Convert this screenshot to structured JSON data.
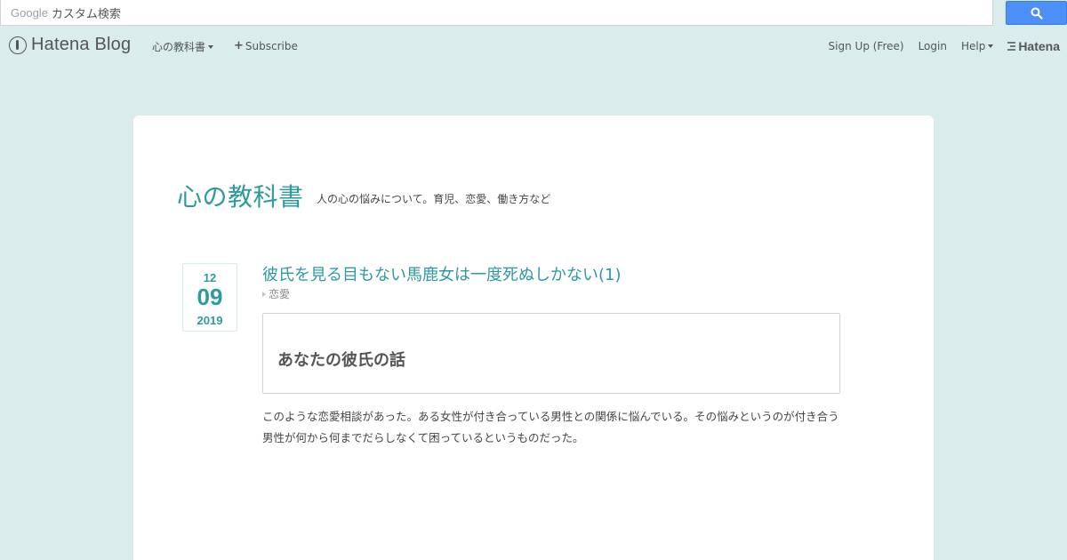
{
  "search": {
    "google_label": "Google",
    "placeholder": "カスタム検索",
    "button_icon": "search-icon",
    "button_color": "#4b8ff7"
  },
  "header": {
    "brand": "Hatena Blog",
    "blog_menu": "心の教科書",
    "subscribe": "Subscribe",
    "signup": "Sign Up (Free)",
    "login": "Login",
    "help": "Help",
    "hatena": "Hatena"
  },
  "blog": {
    "title": "心の教科書",
    "description": "人の心の悩みについて。育児、恋愛、働き方など",
    "accent_color": "#2e9a9e"
  },
  "entry": {
    "date": {
      "month": "12",
      "day": "09",
      "year": "2019"
    },
    "title": "彼氏を見る目もない馬鹿女は一度死ぬしかない(1)",
    "category": "恋愛",
    "toc_heading": "あなたの彼氏の話",
    "body": "このような恋愛相談があった。ある女性が付き合っている男性との関係に悩んでいる。その悩みというのが付き合う男性が何から何までだらしなくて困っているというものだった。"
  }
}
